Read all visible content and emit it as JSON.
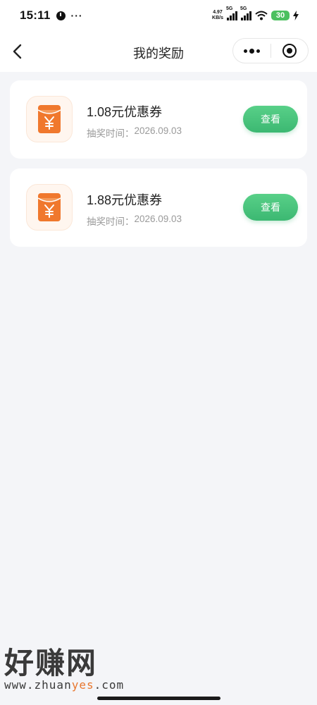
{
  "status_bar": {
    "time": "15:11",
    "more": "···",
    "net_speed_value": "4.97",
    "net_speed_unit": "KB/s",
    "sim1": "5G",
    "sim2": "5G",
    "battery": "30"
  },
  "nav": {
    "title": "我的奖励"
  },
  "rewards": [
    {
      "name": "1.08元优惠券",
      "time_label": "抽奖时间：",
      "time_value": "2026.09.03",
      "action": "查看"
    },
    {
      "name": "1.88元优惠券",
      "time_label": "抽奖时间：",
      "time_value": "2026.09.03",
      "action": "查看"
    }
  ],
  "watermark": {
    "brand": "好赚网",
    "url_prefix": "www.zhuan",
    "url_highlight": "yes",
    "url_suffix": ".com"
  },
  "colors": {
    "accent_green": "#3cb872",
    "coupon_orange": "#f0782d",
    "background": "#f4f5f8"
  },
  "icons": [
    "back-arrow-icon",
    "more-dots-icon",
    "close-miniprogram-icon",
    "red-envelope-icon"
  ]
}
